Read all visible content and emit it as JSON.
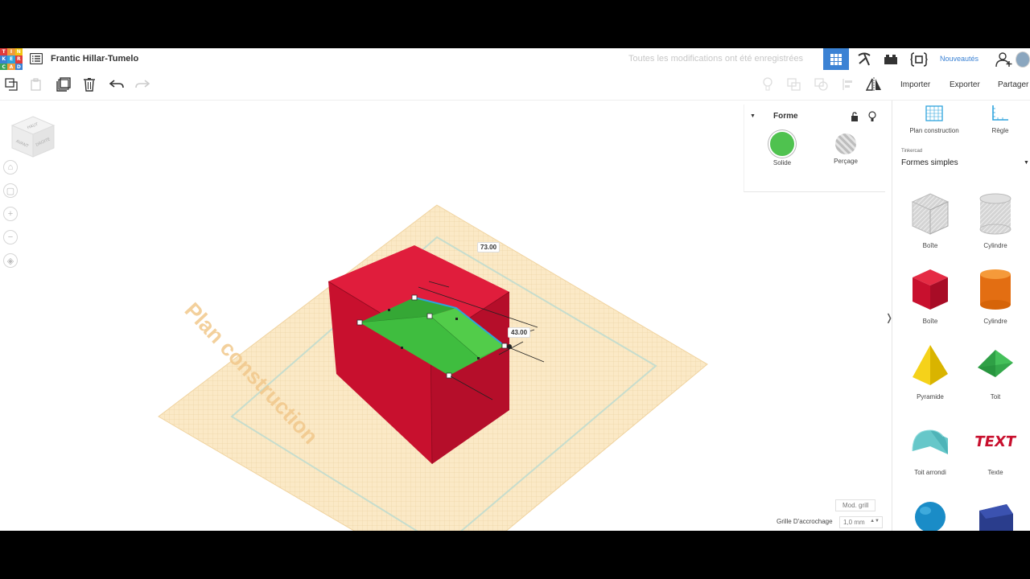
{
  "app": {
    "logo_letters": [
      "T",
      "I",
      "N",
      "K",
      "E",
      "R",
      "C",
      "A",
      "D"
    ],
    "logo_colors": [
      "#e03b3b",
      "#f19a3a",
      "#f1c40f",
      "#3b82d4",
      "#2ea3dd",
      "#e03b3b",
      "#3aa35a",
      "#f19a3a",
      "#3b82d4"
    ],
    "title": "Frantic Hillar-Tumelo",
    "save_status": "Toutes les modifications ont été enregistrées",
    "whats_new": "Nouveautés",
    "accent_color": "#3b82d4"
  },
  "toolbar": {
    "import_label": "Importer",
    "export_label": "Exporter",
    "share_label": "Partager"
  },
  "viewcube": {
    "top": "HAUT",
    "front": "AVANT",
    "right": "DROITE"
  },
  "workplane": {
    "label": "Plan construction"
  },
  "dimensions": {
    "width": "73.00",
    "depth": "43.00"
  },
  "inspector": {
    "title": "Forme",
    "solid_label": "Solide",
    "solid_color": "#4fc24f",
    "hole_label": "Perçage"
  },
  "right_panel": {
    "workplane_tool": "Plan construction",
    "ruler_tool": "Règle",
    "library_heading": "Tinkercad",
    "library_selected": "Formes simples",
    "shapes": [
      {
        "label": "Boîte",
        "icon": "box-hole-icon"
      },
      {
        "label": "Cylindre",
        "icon": "cylinder-hole-icon"
      },
      {
        "label": "Boîte",
        "icon": "box-icon"
      },
      {
        "label": "Cylindre",
        "icon": "cylinder-icon"
      },
      {
        "label": "Pyramide",
        "icon": "pyramid-icon"
      },
      {
        "label": "Toit",
        "icon": "roof-icon"
      },
      {
        "label": "Toit arrondi",
        "icon": "round-roof-icon"
      },
      {
        "label": "Texte",
        "icon": "text-icon"
      }
    ],
    "shape_text_sample": "TEXT"
  },
  "grid": {
    "edit_grid_label": "Mod. grill",
    "snap_label": "Grille D'accrochage",
    "snap_value": "1,0 mm"
  }
}
